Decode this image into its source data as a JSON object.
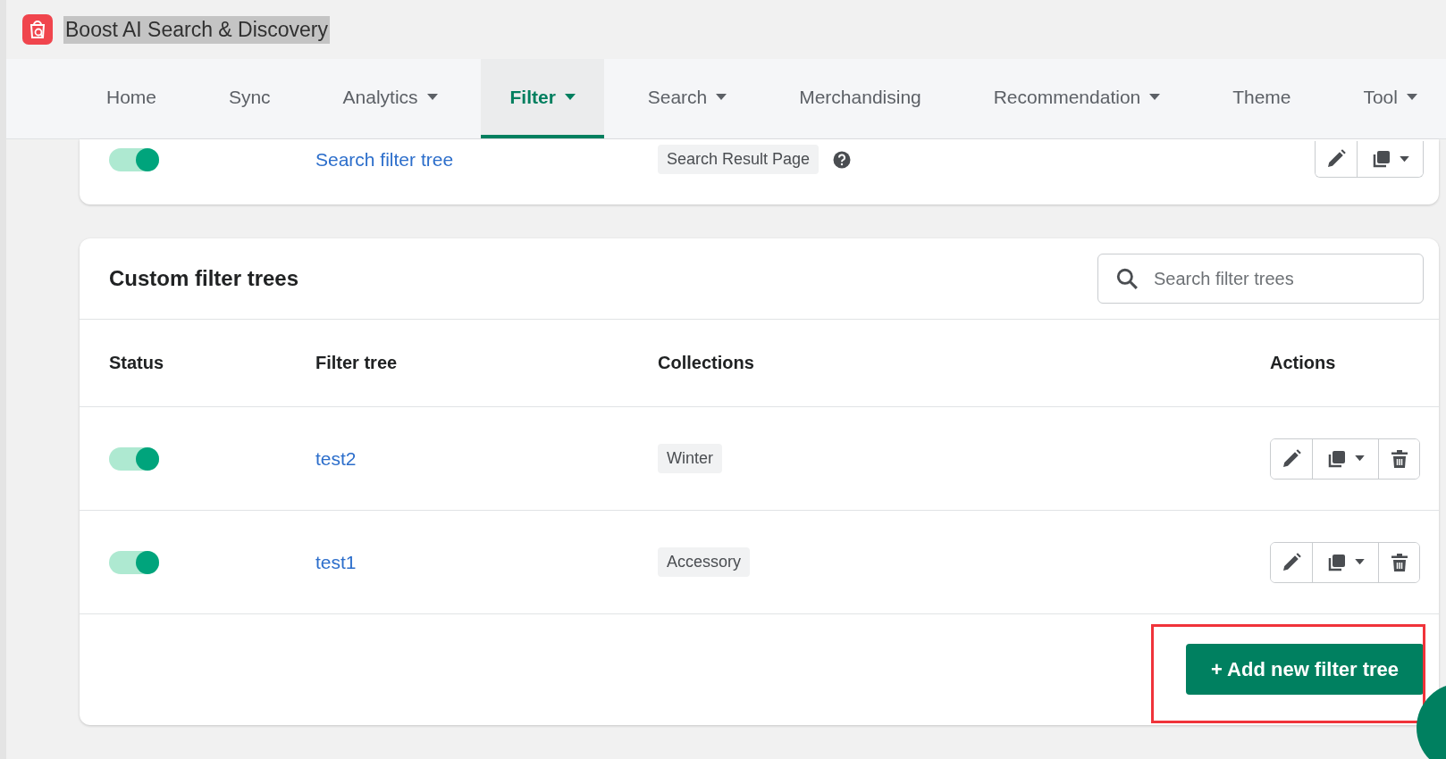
{
  "app": {
    "title": "Boost AI Search & Discovery"
  },
  "nav": [
    {
      "label": "Home",
      "selected": false,
      "dropdown": false
    },
    {
      "label": "Sync",
      "selected": false,
      "dropdown": false
    },
    {
      "label": "Analytics",
      "selected": false,
      "dropdown": true
    },
    {
      "label": "Filter",
      "selected": true,
      "dropdown": true
    },
    {
      "label": "Search",
      "selected": false,
      "dropdown": true
    },
    {
      "label": "Merchandising",
      "selected": false,
      "dropdown": false
    },
    {
      "label": "Recommendation",
      "selected": false,
      "dropdown": true
    },
    {
      "label": "Theme",
      "selected": false,
      "dropdown": false
    },
    {
      "label": "Tool",
      "selected": false,
      "dropdown": true
    }
  ],
  "default_tree": {
    "on": true,
    "name": "Search filter tree",
    "page": "Search Result Page"
  },
  "custom": {
    "title": "Custom filter trees",
    "search": {
      "placeholder": "Search filter trees"
    },
    "columns": [
      "Status",
      "Filter tree",
      "Collections",
      "Actions"
    ],
    "rows": [
      {
        "on": true,
        "name": "test2",
        "collection": "Winter"
      },
      {
        "on": true,
        "name": "test1",
        "collection": "Accessory"
      }
    ],
    "add_button": "+ Add new filter tree"
  }
}
